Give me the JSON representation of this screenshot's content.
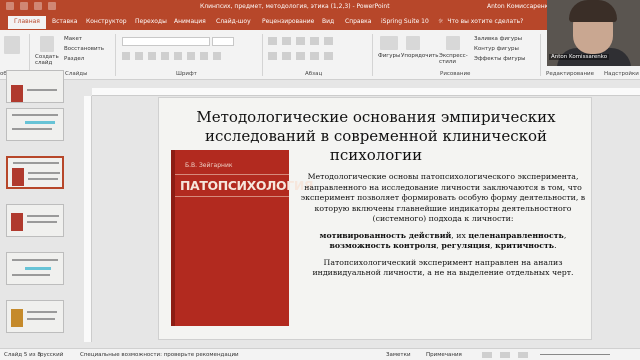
{
  "titlebar": {
    "title": "Клинпсих, предмет, методология, этика (1,2,3)  -  PowerPoint",
    "user": "Anton Комиссаренко"
  },
  "tabs": [
    "Главная",
    "Вставка",
    "Конструктор",
    "Переходы",
    "Анимация",
    "Слайд-шоу",
    "Рецензирование",
    "Вид",
    "Справка",
    "iSpring Suite 10"
  ],
  "active_tab": "Главная",
  "search_placeholder": "Что вы хотите сделать?",
  "ribbon": {
    "create_slide": "Создать слайд",
    "layout": "Макет",
    "reset": "Восстановить",
    "section": "Раздел",
    "shapes": "Фигуры",
    "arrange": "Упорядочить",
    "quick_styles": "Экспресс-стили",
    "fill": "Заливка фигуры",
    "outline": "Контур фигуры",
    "effects": "Эффекты фигуры",
    "editing": "Редактирование",
    "addins": "Надстройки",
    "groups": {
      "clipboard": "обмена",
      "slides": "Слайды",
      "font": "Шрифт",
      "paragraph": "Абзац",
      "drawing": "Рисование"
    }
  },
  "slide": {
    "title_line1": "Методологические основания эмпирических",
    "title_line2": "исследований в современной клинической психологии",
    "book_author": "Б.В. Зейгарник",
    "book_title": "ПАТОПСИХОЛОГИЯ",
    "para1": "Методологические основы патопсихологического эксперимента, направленного на исследование личности заключаются в том, что эксперимент позволяет формировать особую форму деятельности, в которую включены главнейшие индикаторы деятельностного (системного) подхода к личности:",
    "kw_motivation": "мотивированность действий",
    "sep1": ", их ",
    "kw_purpose": "целенаправленность",
    "sep2": ", ",
    "kw_possibility": "возможность",
    "sep3": " ",
    "kw_control": "контроля",
    "sep4": ", ",
    "kw_regulation": "регуляция",
    "sep5": ", ",
    "kw_criticality": "критичность",
    "end_dot": ".",
    "para3": "Патопсихологический эксперимент направлен на анализ индивидуальной личности, а не на выделение отдельных черт."
  },
  "webcam": {
    "name": "Anton Komissarenko"
  },
  "status": {
    "slide_counter": "Слайд 5 из 8",
    "language": "русский",
    "accessibility": "Специальные возможности: проверьте рекомендации",
    "notes": "Заметки",
    "comments": "Примечания"
  },
  "colors": {
    "accent": "#b7472a",
    "book": "#b22a1f",
    "thumb_highlight": "#67c3d6"
  }
}
